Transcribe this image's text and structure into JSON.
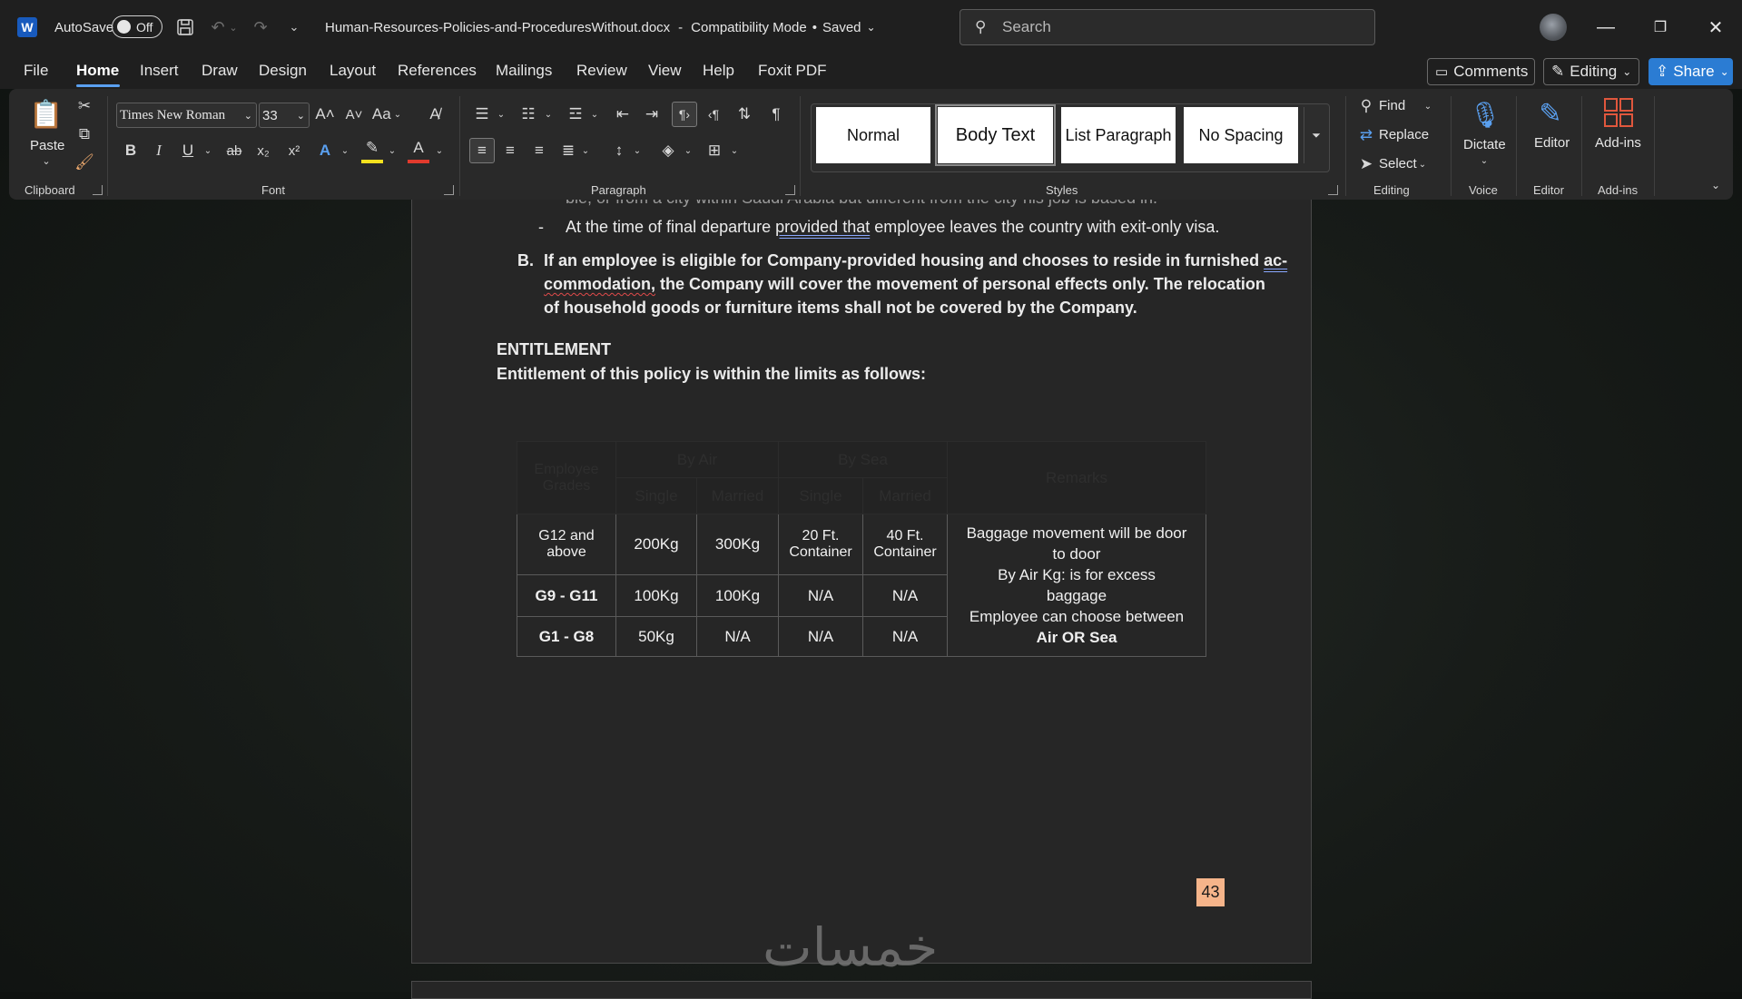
{
  "titlebar": {
    "autosave_label": "AutoSave",
    "autosave_state": "Off",
    "doc_title": "Human-Resources-Policies-and-ProceduresWithout.docx",
    "title_sep": "-",
    "mode": "Compatibility Mode",
    "dot": "•",
    "save_state": "Saved",
    "search_placeholder": "Search"
  },
  "menu": {
    "tabs": [
      "File",
      "Home",
      "Insert",
      "Draw",
      "Design",
      "Layout",
      "References",
      "Mailings",
      "Review",
      "View",
      "Help",
      "Foxit PDF"
    ],
    "comments": "Comments",
    "editing": "Editing",
    "share": "Share"
  },
  "ribbon": {
    "clipboard": {
      "paste": "Paste",
      "label": "Clipboard"
    },
    "font": {
      "family": "Times New Roman",
      "size": "33",
      "change_case": "Aa",
      "label": "Font"
    },
    "paragraph": {
      "label": "Paragraph"
    },
    "styles": {
      "items": [
        "Normal",
        "Body Text",
        "List Paragraph",
        "No Spacing"
      ],
      "selected": "Body Text",
      "label": "Styles"
    },
    "editing": {
      "find": "Find",
      "replace": "Replace",
      "select": "Select",
      "label": "Editing"
    },
    "voice": {
      "dictate": "Dictate",
      "label": "Voice"
    },
    "editor": {
      "editor": "Editor",
      "label": "Editor"
    },
    "addins": {
      "addins": "Add-ins",
      "label": "Add-ins"
    }
  },
  "document": {
    "cut_line": "ble, or from a city within Saudi Arabia but different from the city his job is based in.",
    "bullet_dash": "-",
    "bullet_pre": "At the time of final departure ",
    "bullet_underlined": "provided that",
    "bullet_post": " employee leaves the country with exit-only visa.",
    "item_b_marker": "B.",
    "item_b_line1_pre": "If an employee is eligible for Company-provided housing and chooses to reside in furnished ",
    "item_b_line1_err": "ac-",
    "item_b_line2_err": "commodation,",
    "item_b_line2_post": " the Company will cover the movement of personal effects only. The relocation",
    "item_b_line3": "of household goods or furniture items shall not be covered by the Company.",
    "heading": "ENTITLEMENT",
    "intro": "Entitlement of this policy is within the limits as follows:",
    "page_number": "43",
    "watermark": "خمسات"
  },
  "table": {
    "headers": {
      "grades": "Employee Grades",
      "by_air": "By Air",
      "by_sea": "By Sea",
      "remarks": "Remarks",
      "single": "Single",
      "married": "Married"
    },
    "rows": [
      {
        "grade": "G12 and above",
        "air_single": "200Kg",
        "air_married": "300Kg",
        "sea_single": "20 Ft. Container",
        "sea_married": "40 Ft. Container"
      },
      {
        "grade": "G9 - G11",
        "air_single": "100Kg",
        "air_married": "100Kg",
        "sea_single": "N/A",
        "sea_married": "N/A"
      },
      {
        "grade": "G1 - G8",
        "air_single": "50Kg",
        "air_married": "N/A",
        "sea_single": "N/A",
        "sea_married": "N/A"
      }
    ],
    "remarks_text": {
      "line1": "Baggage movement will be door to door",
      "line2": "By Air Kg: is for excess baggage",
      "line3": "Employee can choose between",
      "line4": "Air OR Sea"
    }
  }
}
